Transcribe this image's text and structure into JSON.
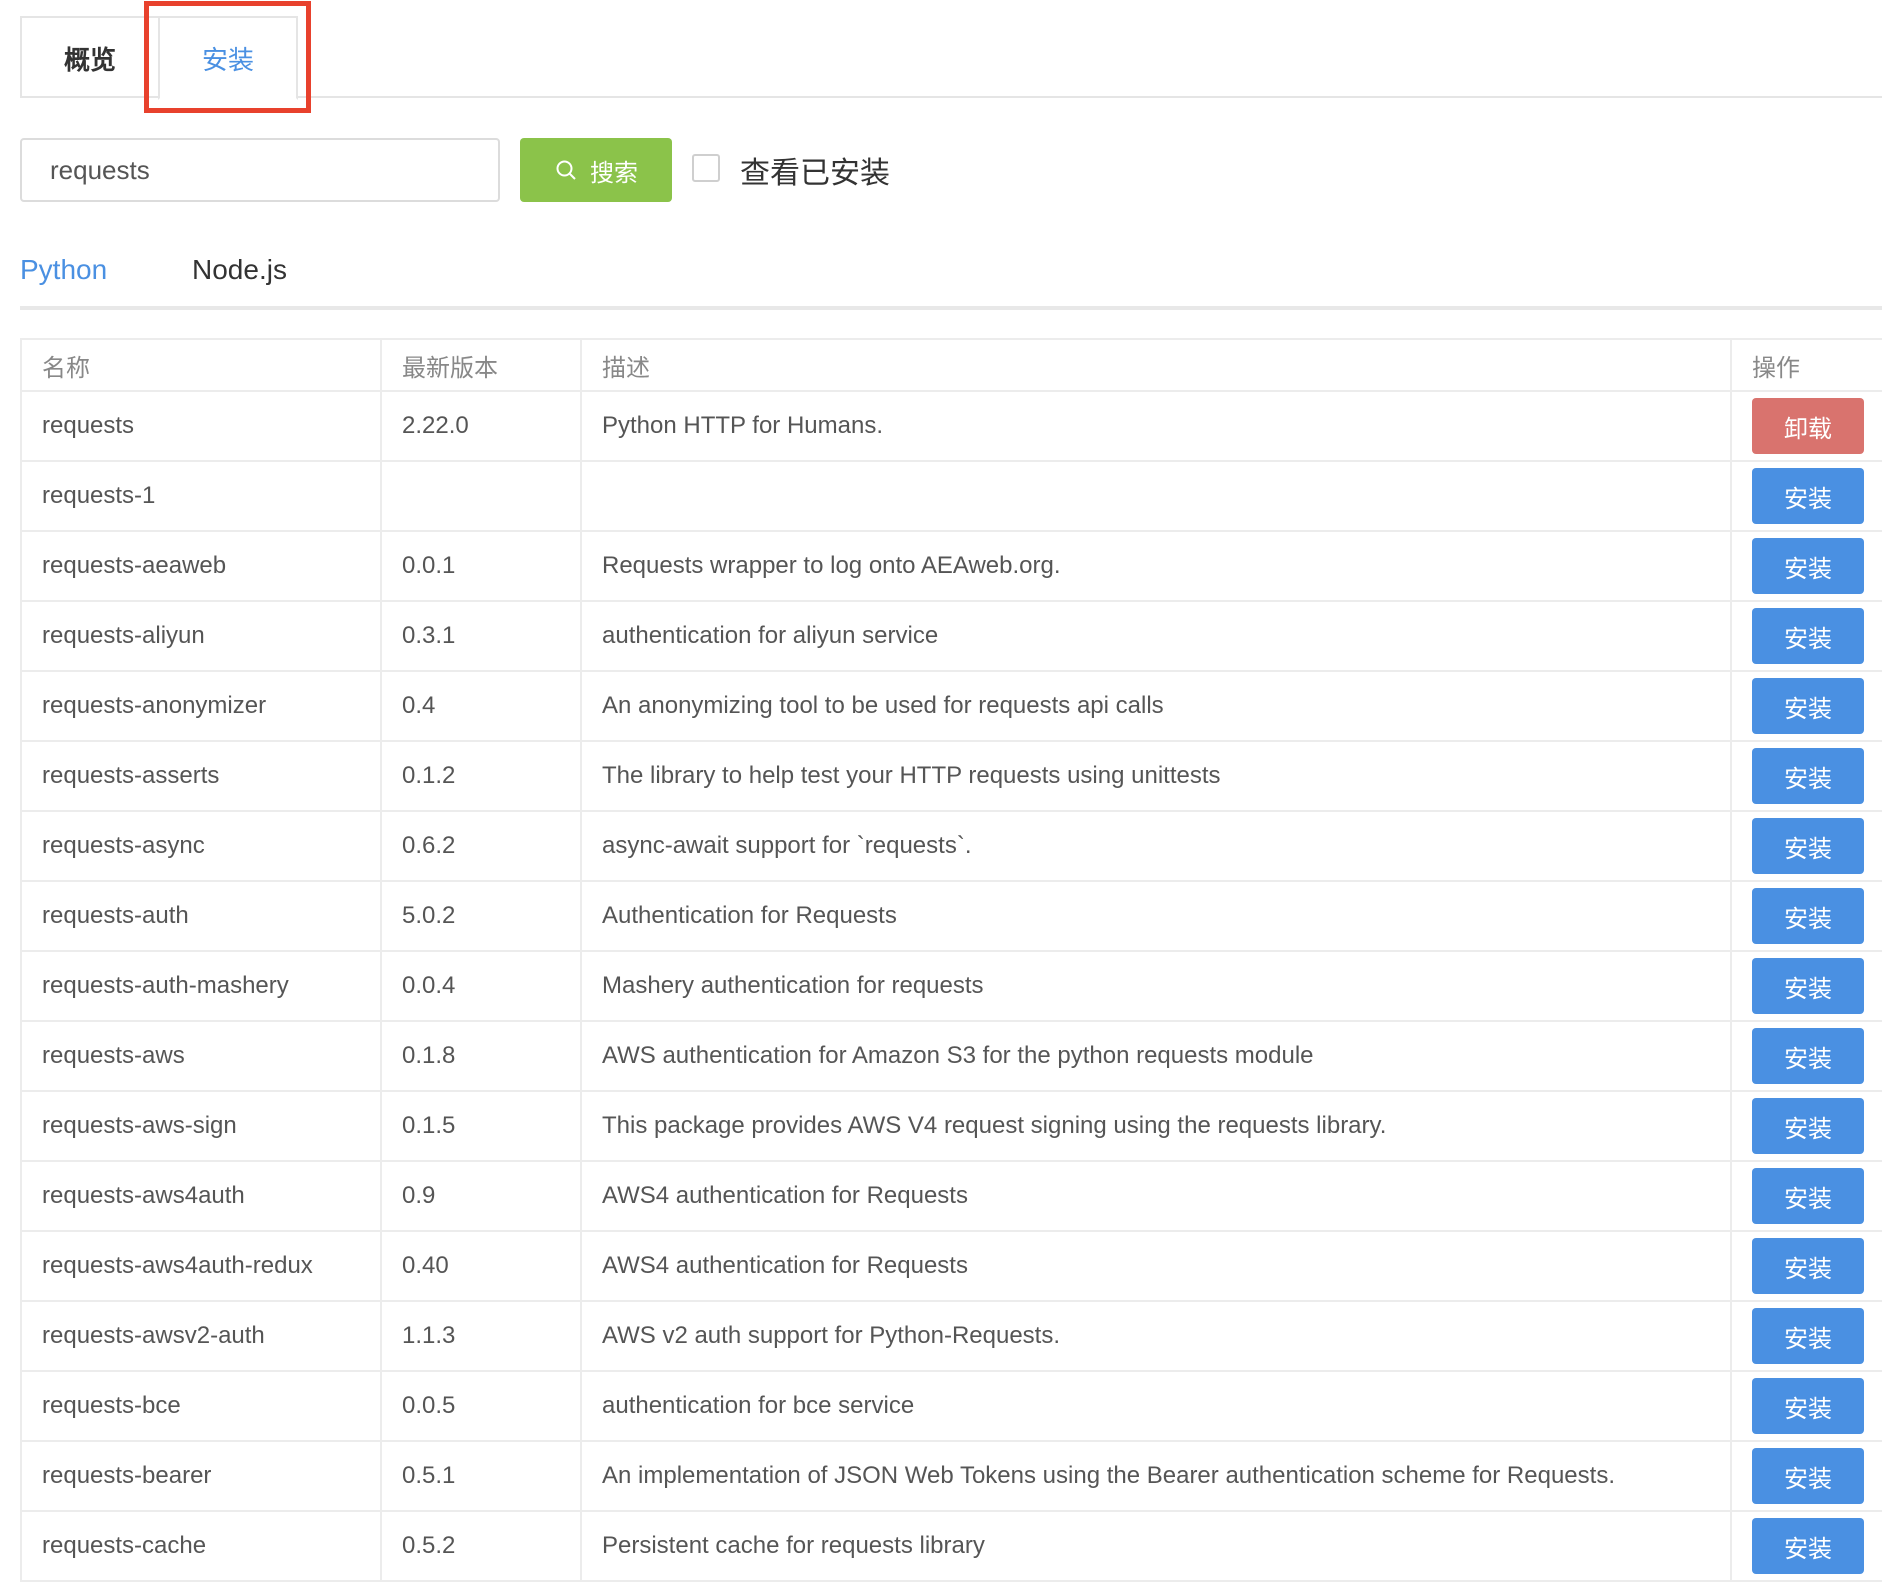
{
  "top_tabs": {
    "overview": "概览",
    "install": "安装"
  },
  "search": {
    "value": "requests",
    "button_label": "搜索",
    "show_installed_label": "查看已安装"
  },
  "lang_tabs": {
    "python": "Python",
    "node": "Node.js"
  },
  "table": {
    "headers": [
      "名称",
      "最新版本",
      "描述",
      "操作"
    ],
    "rows": [
      {
        "name": "requests",
        "version": "2.22.0",
        "desc": "Python HTTP for Humans.",
        "action": "卸载"
      },
      {
        "name": "requests-1",
        "version": "",
        "desc": "",
        "action": "安装"
      },
      {
        "name": "requests-aeaweb",
        "version": "0.0.1",
        "desc": "Requests wrapper to log onto AEAweb.org.",
        "action": "安装"
      },
      {
        "name": "requests-aliyun",
        "version": "0.3.1",
        "desc": "authentication for aliyun service",
        "action": "安装"
      },
      {
        "name": "requests-anonymizer",
        "version": "0.4",
        "desc": "An anonymizing tool to be used for requests api calls",
        "action": "安装"
      },
      {
        "name": "requests-asserts",
        "version": "0.1.2",
        "desc": "The library to help test your HTTP requests using unittests",
        "action": "安装"
      },
      {
        "name": "requests-async",
        "version": "0.6.2",
        "desc": "async-await support for `requests`.",
        "action": "安装"
      },
      {
        "name": "requests-auth",
        "version": "5.0.2",
        "desc": "Authentication for Requests",
        "action": "安装"
      },
      {
        "name": "requests-auth-mashery",
        "version": "0.0.4",
        "desc": "Mashery authentication for requests",
        "action": "安装"
      },
      {
        "name": "requests-aws",
        "version": "0.1.8",
        "desc": "AWS authentication for Amazon S3 for the python requests module",
        "action": "安装"
      },
      {
        "name": "requests-aws-sign",
        "version": "0.1.5",
        "desc": "This package provides AWS V4 request signing using the requests library.",
        "action": "安装"
      },
      {
        "name": "requests-aws4auth",
        "version": "0.9",
        "desc": "AWS4 authentication for Requests",
        "action": "安装"
      },
      {
        "name": "requests-aws4auth-redux",
        "version": "0.40",
        "desc": "AWS4 authentication for Requests",
        "action": "安装"
      },
      {
        "name": "requests-awsv2-auth",
        "version": "1.1.3",
        "desc": "AWS v2 auth support for Python-Requests.",
        "action": "安装"
      },
      {
        "name": "requests-bce",
        "version": "0.0.5",
        "desc": "authentication for bce service",
        "action": "安装"
      },
      {
        "name": "requests-bearer",
        "version": "0.5.1",
        "desc": "An implementation of JSON Web Tokens using the Bearer authentication scheme for Requests.",
        "action": "安装"
      },
      {
        "name": "requests-cache",
        "version": "0.5.2",
        "desc": "Persistent cache for requests library",
        "action": "安装"
      }
    ]
  },
  "colors": {
    "accent": "#4a90e2",
    "search_button": "#8bc34a",
    "uninstall": "#d9736e",
    "highlight": "#e8412d"
  },
  "icons": {
    "search": "search-icon"
  }
}
